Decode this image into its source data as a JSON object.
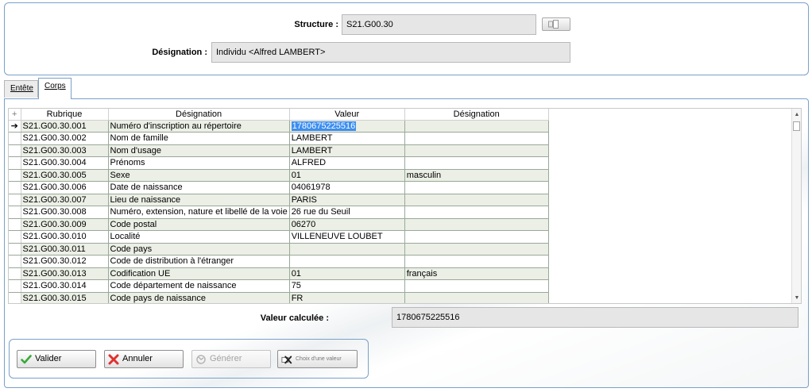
{
  "header": {
    "structure_label": "Structure :",
    "structure_value": "S21.G00.30",
    "designation_label": "Désignation :",
    "designation_value": "Individu <Alfred LAMBERT>"
  },
  "tabs": [
    {
      "label": "Entête",
      "active": false
    },
    {
      "label": "Corps",
      "active": true
    }
  ],
  "grid": {
    "corner_symbol": "+",
    "columns": [
      "Rubrique",
      "Désignation",
      "Valeur",
      "Désignation"
    ],
    "current_row_marker": "➔",
    "rows": [
      {
        "rubrique": "S21.G00.30.001",
        "designation": "Numéro d'inscription au répertoire",
        "valeur": "1780675225516",
        "designation2": "",
        "selected": true
      },
      {
        "rubrique": "S21.G00.30.002",
        "designation": "Nom de famille",
        "valeur": "LAMBERT",
        "designation2": ""
      },
      {
        "rubrique": "S21.G00.30.003",
        "designation": "Nom d'usage",
        "valeur": "LAMBERT",
        "designation2": ""
      },
      {
        "rubrique": "S21.G00.30.004",
        "designation": "Prénoms",
        "valeur": "ALFRED",
        "designation2": ""
      },
      {
        "rubrique": "S21.G00.30.005",
        "designation": "Sexe",
        "valeur": "01",
        "designation2": "masculin"
      },
      {
        "rubrique": "S21.G00.30.006",
        "designation": "Date de naissance",
        "valeur": "04061978",
        "designation2": ""
      },
      {
        "rubrique": "S21.G00.30.007",
        "designation": "Lieu de naissance",
        "valeur": "PARIS",
        "designation2": ""
      },
      {
        "rubrique": "S21.G00.30.008",
        "designation": "Numéro, extension, nature et libellé de la voie",
        "valeur": "26 rue du Seuil",
        "designation2": ""
      },
      {
        "rubrique": "S21.G00.30.009",
        "designation": "Code postal",
        "valeur": "06270",
        "designation2": ""
      },
      {
        "rubrique": "S21.G00.30.010",
        "designation": "Localité",
        "valeur": "VILLENEUVE LOUBET",
        "designation2": ""
      },
      {
        "rubrique": "S21.G00.30.011",
        "designation": "Code pays",
        "valeur": "",
        "designation2": ""
      },
      {
        "rubrique": "S21.G00.30.012",
        "designation": "Code de distribution à l'étranger",
        "valeur": "",
        "designation2": ""
      },
      {
        "rubrique": "S21.G00.30.013",
        "designation": "Codification UE",
        "valeur": "01",
        "designation2": "français"
      },
      {
        "rubrique": "S21.G00.30.014",
        "designation": "Code département de naissance",
        "valeur": "75",
        "designation2": ""
      },
      {
        "rubrique": "S21.G00.30.015",
        "designation": "Code pays de naissance",
        "valeur": "FR",
        "designation2": ""
      }
    ]
  },
  "computed": {
    "label": "Valeur calculée :",
    "value": "1780675225516"
  },
  "buttons": {
    "validate": "Valider",
    "cancel": "Annuler",
    "generate": "Générer",
    "choose_value": "Choix d'une valeur"
  },
  "colors": {
    "accent_border": "#7aa0c8",
    "row_alt": "#ebefe5",
    "selection": "#3d8ef0"
  }
}
